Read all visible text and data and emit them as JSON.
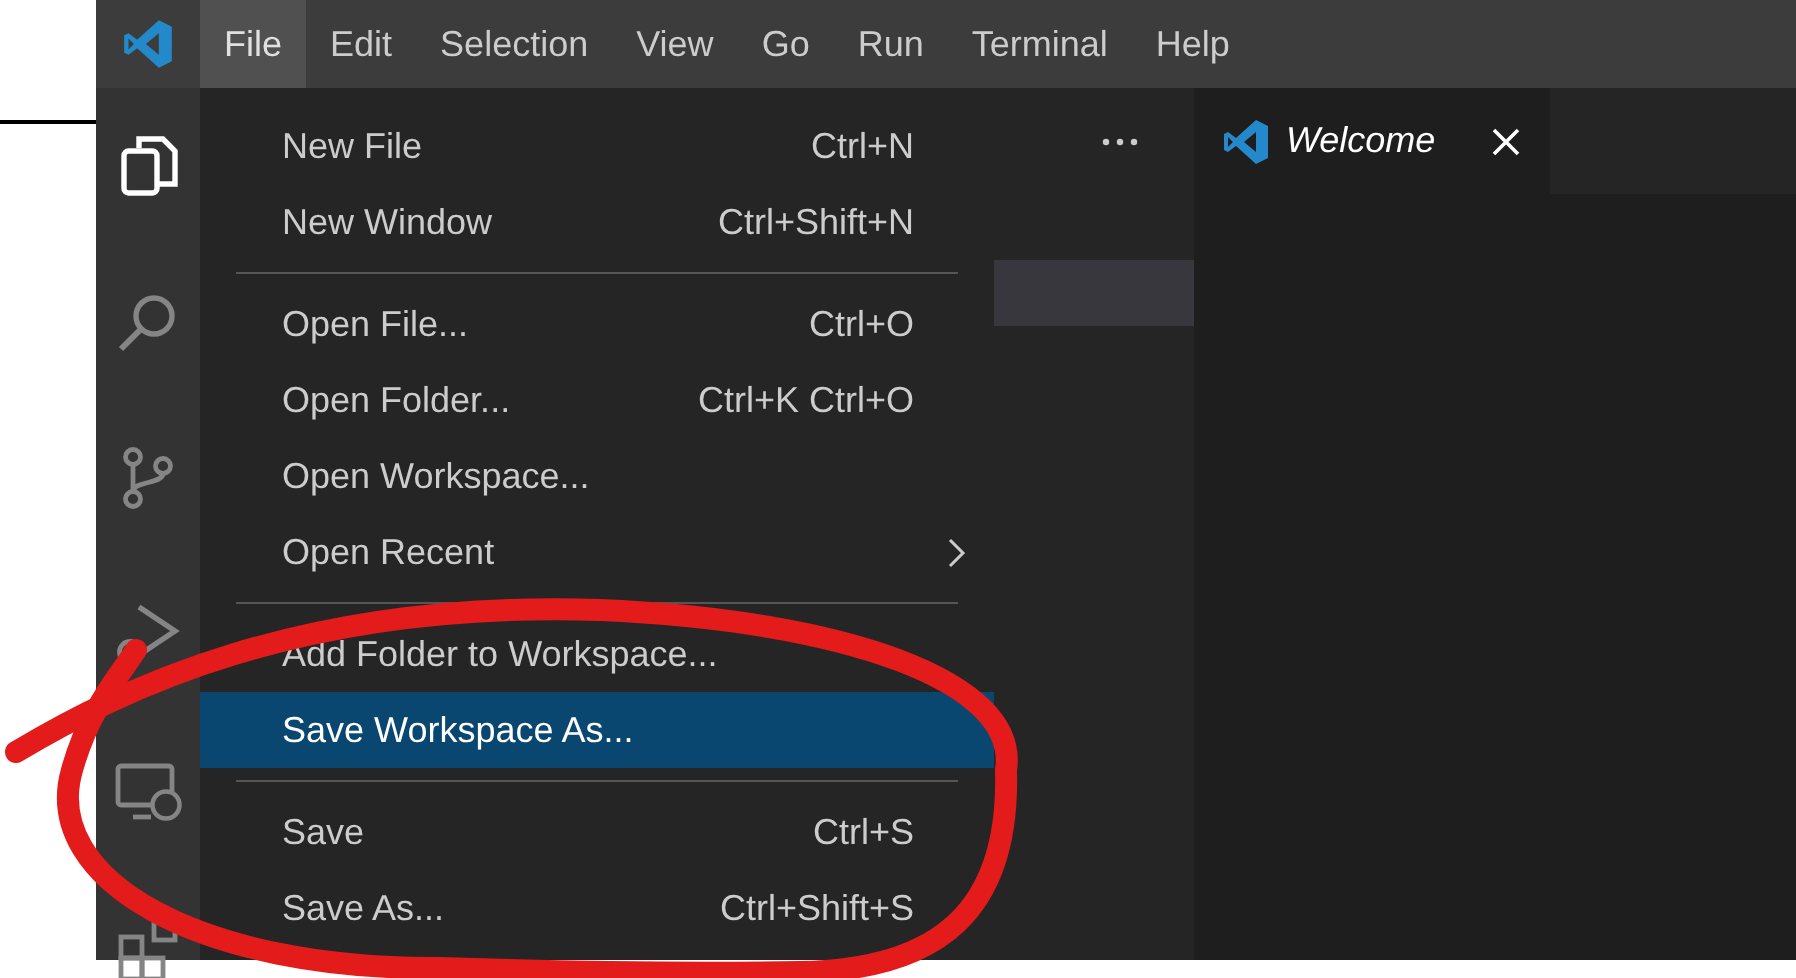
{
  "menu_bar": {
    "items": [
      {
        "label": "File",
        "selected": true
      },
      {
        "label": "Edit",
        "selected": false
      },
      {
        "label": "Selection",
        "selected": false
      },
      {
        "label": "View",
        "selected": false
      },
      {
        "label": "Go",
        "selected": false
      },
      {
        "label": "Run",
        "selected": false
      },
      {
        "label": "Terminal",
        "selected": false
      },
      {
        "label": "Help",
        "selected": false
      }
    ]
  },
  "activity_bar": {
    "items": [
      {
        "kind": "explorer",
        "selected": true
      },
      {
        "kind": "search",
        "selected": false
      },
      {
        "kind": "source_control",
        "selected": false
      },
      {
        "kind": "run_debug",
        "selected": false
      },
      {
        "kind": "remote",
        "selected": false
      },
      {
        "kind": "extensions",
        "selected": false
      }
    ]
  },
  "file_menu": {
    "items": [
      {
        "kind": "item",
        "label": "New File",
        "shortcut": "Ctrl+N",
        "selected": false
      },
      {
        "kind": "item",
        "label": "New Window",
        "shortcut": "Ctrl+Shift+N",
        "selected": false
      },
      {
        "kind": "separator"
      },
      {
        "kind": "item",
        "label": "Open File...",
        "shortcut": "Ctrl+O",
        "selected": false
      },
      {
        "kind": "item",
        "label": "Open Folder...",
        "shortcut": "Ctrl+K Ctrl+O",
        "selected": false
      },
      {
        "kind": "item",
        "label": "Open Workspace...",
        "selected": false
      },
      {
        "kind": "submenu",
        "label": "Open Recent",
        "selected": false
      },
      {
        "kind": "separator"
      },
      {
        "kind": "item",
        "label": "Add Folder to Workspace...",
        "selected": false
      },
      {
        "kind": "item",
        "label": "Save Workspace As...",
        "selected": true
      },
      {
        "kind": "separator"
      },
      {
        "kind": "item",
        "label": "Save",
        "shortcut": "Ctrl+S",
        "selected": false
      },
      {
        "kind": "item",
        "label": "Save As...",
        "shortcut": "Ctrl+Shift+S",
        "selected": false
      }
    ]
  },
  "editor": {
    "tabs": [
      {
        "label": "Welcome",
        "selected": true
      }
    ]
  }
}
